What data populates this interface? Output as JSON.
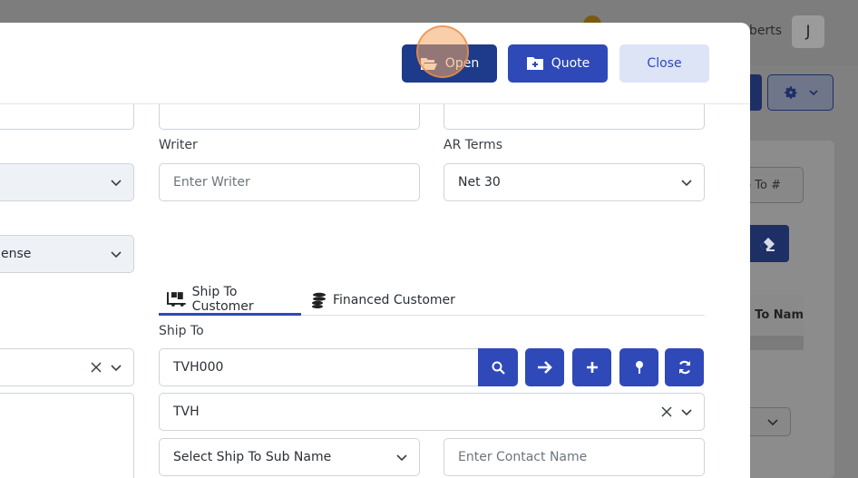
{
  "background": {
    "user_name_fragment": "berts",
    "avatar_initial": "J",
    "ship_to_filter_placeholder": "p To #",
    "table_header_fragment": "p To Nam"
  },
  "header": {
    "open_label": "Open",
    "quote_label": "Quote",
    "close_label": "Close"
  },
  "form": {
    "writer_label": "Writer",
    "writer_placeholder": "Enter Writer",
    "ar_terms_label": "AR Terms",
    "ar_terms_value": "Net 30",
    "left_select_value": "ense",
    "ship_to_label": "Ship To",
    "ship_to_code": "TVH000",
    "ship_to_name": "TVH",
    "sub_name_placeholder": "Select Ship To Sub Name",
    "contact_placeholder": "Enter Contact Name"
  },
  "tabs": {
    "ship_to_customer": "Ship To Customer",
    "financed_customer": "Financed Customer"
  },
  "icons": {
    "open": "folder-open-icon",
    "quote": "folder-plus-icon",
    "search": "search-icon",
    "go": "arrow-right-icon",
    "add": "plus-icon",
    "location": "map-pin-icon",
    "refresh": "refresh-icon"
  },
  "colors": {
    "primary": "#2f49b8",
    "primary_dark": "#1e3a8a",
    "close_bg": "#dde4f6"
  }
}
